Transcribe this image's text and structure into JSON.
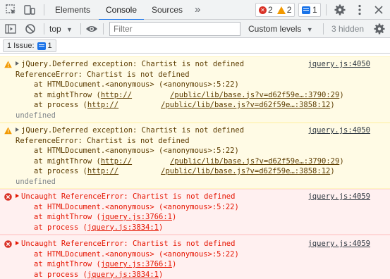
{
  "tabs": {
    "items": [
      "Elements",
      "Console",
      "Sources"
    ],
    "more": "»",
    "errors": "2",
    "warnings": "2",
    "issues": "1"
  },
  "toolbar": {
    "context": "top",
    "filter_placeholder": "Filter",
    "levels": "Custom levels",
    "hidden": "3 hidden"
  },
  "issuebar": {
    "label": "1 Issue:",
    "count": "1"
  },
  "messages": [
    {
      "level": "warning",
      "source": "jquery.js:4050",
      "text": "jQuery.Deferred exception: Chartist is not defined",
      "line2": "ReferenceError: Chartist is not defined",
      "frames": [
        {
          "prefix": "at HTMLDocument.<anonymous> (<anonymous>:5:22)",
          "link": "",
          "suffix": ""
        },
        {
          "prefix": "at mightThrow (",
          "link_a": "http://",
          "link_b": "/public/lib/base.js?v=d62f59e…:3790:29",
          "suffix": ")"
        },
        {
          "prefix": "at process (",
          "link_a": "http://",
          "link_b": "/public/lib/base.js?v=d62f59e…:3858:12",
          "suffix": ")"
        }
      ],
      "result": "undefined"
    },
    {
      "level": "warning",
      "source": "jquery.js:4050",
      "text": "jQuery.Deferred exception: Chartist is not defined",
      "line2": "ReferenceError: Chartist is not defined",
      "frames": [
        {
          "prefix": "at HTMLDocument.<anonymous> (<anonymous>:5:22)",
          "link": "",
          "suffix": ""
        },
        {
          "prefix": "at mightThrow (",
          "link_a": "http://",
          "link_b": "/public/lib/base.js?v=d62f59e…:3790:29",
          "suffix": ")"
        },
        {
          "prefix": "at process (",
          "link_a": "http://",
          "link_b": "/public/lib/base.js?v=d62f59e…:3858:12",
          "suffix": ")"
        }
      ],
      "result": "undefined"
    },
    {
      "level": "error",
      "source": "jquery.js:4059",
      "text": "Uncaught ReferenceError: Chartist is not defined",
      "frames": [
        {
          "prefix": "at HTMLDocument.<anonymous> (<anonymous>:5:22)",
          "link": "",
          "suffix": ""
        },
        {
          "prefix": "at mightThrow (",
          "link": "jquery.js:3766:1",
          "suffix": ")"
        },
        {
          "prefix": "at process (",
          "link": "jquery.js:3834:1",
          "suffix": ")"
        }
      ]
    },
    {
      "level": "error",
      "source": "jquery.js:4059",
      "text": "Uncaught ReferenceError: Chartist is not defined",
      "frames": [
        {
          "prefix": "at HTMLDocument.<anonymous> (<anonymous>:5:22)",
          "link": "",
          "suffix": ""
        },
        {
          "prefix": "at mightThrow (",
          "link": "jquery.js:3766:1",
          "suffix": ")"
        },
        {
          "prefix": "at process (",
          "link": "jquery.js:3834:1",
          "suffix": ")"
        }
      ]
    }
  ],
  "colors": {
    "accent": "#1a73e8",
    "error": "#d93025",
    "warning": "#f29900",
    "warn_bg": "#fffbe5",
    "error_bg": "#fff0f0"
  }
}
